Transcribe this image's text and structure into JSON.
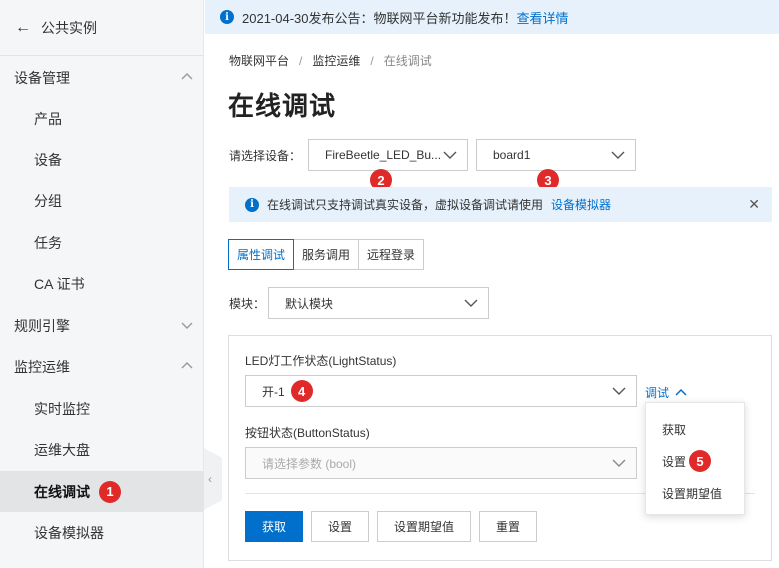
{
  "sidebar": {
    "back_label": "公共实例",
    "groups": [
      {
        "label": "设备管理",
        "expanded": true
      },
      {
        "label": "规则引擎",
        "expanded": false
      },
      {
        "label": "监控运维",
        "expanded": true
      }
    ],
    "items": [
      {
        "label": "产品"
      },
      {
        "label": "设备"
      },
      {
        "label": "分组"
      },
      {
        "label": "任务"
      },
      {
        "label": "CA 证书"
      },
      {
        "label": "实时监控"
      },
      {
        "label": "运维大盘"
      },
      {
        "label": "在线调试",
        "active": true,
        "badge": "1"
      },
      {
        "label": "设备模拟器"
      }
    ]
  },
  "announcement": {
    "text": "2021-04-30发布公告：物联网平台新功能发布！",
    "link": "查看详情"
  },
  "breadcrumb": [
    "物联网平台",
    "监控运维",
    "在线调试"
  ],
  "page_title": "在线调试",
  "device": {
    "label": "请选择设备：",
    "product_value": "FireBeetle_LED_Bu...",
    "device_value": "board1",
    "badge_product": "2",
    "badge_device": "3"
  },
  "tip": {
    "text": "在线调试只支持调试真实设备，虚拟设备调试请使用",
    "link": "设备模拟器"
  },
  "tabs": [
    {
      "label": "属性调试",
      "active": true
    },
    {
      "label": "服务调用"
    },
    {
      "label": "远程登录"
    }
  ],
  "module": {
    "label": "模块：",
    "value": "默认模块"
  },
  "fields": [
    {
      "label": "LED灯工作状态(LightStatus)",
      "value": "开-1",
      "badge": "4"
    },
    {
      "label": "按钮状态(ButtonStatus)",
      "placeholder": "请选择参数 (bool)"
    }
  ],
  "debug_link": "调试",
  "popover": {
    "items": [
      "获取",
      "设置",
      "设置期望值"
    ],
    "badge": "5"
  },
  "buttons": {
    "get": "获取",
    "set": "设置",
    "set_desired": "设置期望值",
    "reset": "重置"
  },
  "colors": {
    "accent": "#0070cc",
    "badge": "#e02a2a",
    "info_bg": "#e6f1fb"
  }
}
